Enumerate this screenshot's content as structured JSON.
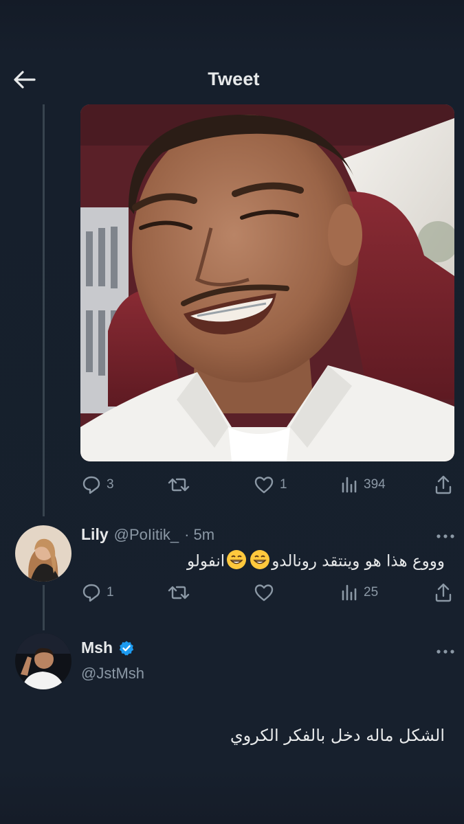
{
  "header": {
    "title": "Tweet"
  },
  "main_tweet": {
    "stats": {
      "replies": "3",
      "likes": "1",
      "views": "394"
    }
  },
  "reply1": {
    "name": "Lily",
    "handle": "@PoIitik_",
    "time": "· 5m",
    "text_before": "وووع هذا هو وينتقد رونالدو",
    "emoji": "😁",
    "text_after": "انفولو",
    "stats": {
      "replies": "1",
      "likes": "",
      "views": "25"
    }
  },
  "reply2": {
    "name": "Msh",
    "handle": "@JstMsh",
    "verified": true,
    "text": "الشكل ماله دخل بالفكر الكروي"
  },
  "icons": {
    "back": "back-arrow-icon",
    "reply": "reply-icon",
    "retweet": "retweet-icon",
    "like": "heart-icon",
    "views": "views-icon",
    "share": "share-icon",
    "more": "more-icon",
    "verified": "verified-icon"
  },
  "colors": {
    "background": "#17202d",
    "text": "#e7e9ea",
    "muted": "#8b98a5",
    "verified": "#1d9bf0"
  }
}
